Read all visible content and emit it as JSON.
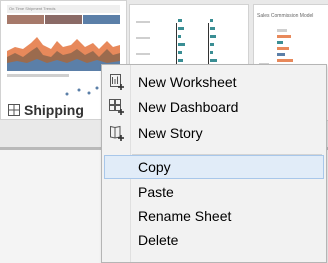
{
  "sorter": {
    "thumbnails": [
      {
        "title": "On Time Shipment Trends"
      },
      {
        "title": "Sales Commission Model"
      }
    ],
    "active_sheet_label": "Shipping"
  },
  "context_menu": {
    "items": [
      {
        "label": "New Worksheet",
        "icon": "new-worksheet-icon"
      },
      {
        "label": "New Dashboard",
        "icon": "new-dashboard-icon"
      },
      {
        "label": "New Story",
        "icon": "new-story-icon"
      },
      {
        "label": "Copy",
        "highlighted": true
      },
      {
        "label": "Paste"
      },
      {
        "label": "Rename Sheet"
      },
      {
        "label": "Delete"
      }
    ]
  },
  "colors": {
    "menu_bg": "#f2f2f2",
    "highlight": "#e1ecf8",
    "highlight_border": "#a8c7ea",
    "chart_blue": "#5b7fa8",
    "chart_orange": "#e8895b",
    "chart_brown": "#9b6b4e",
    "chart_teal": "#3a8e94"
  }
}
